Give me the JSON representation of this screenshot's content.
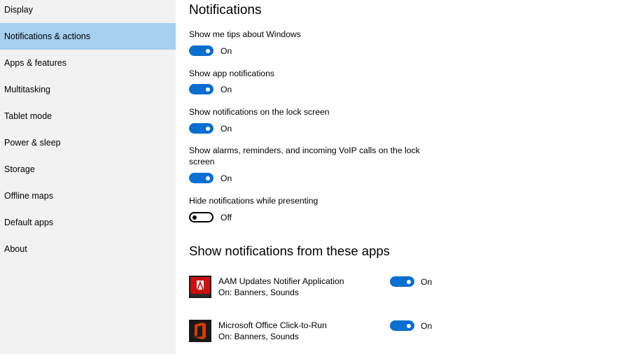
{
  "sidebar": {
    "items": [
      {
        "label": "Display"
      },
      {
        "label": "Notifications & actions"
      },
      {
        "label": "Apps & features"
      },
      {
        "label": "Multitasking"
      },
      {
        "label": "Tablet mode"
      },
      {
        "label": "Power & sleep"
      },
      {
        "label": "Storage"
      },
      {
        "label": "Offline maps"
      },
      {
        "label": "Default apps"
      },
      {
        "label": "About"
      }
    ],
    "selected": "Notifications & actions"
  },
  "main": {
    "title": "Notifications",
    "settings": [
      {
        "label": "Show me tips about Windows",
        "state": "On"
      },
      {
        "label": "Show app notifications",
        "state": "On"
      },
      {
        "label": "Show notifications on the lock screen",
        "state": "On"
      },
      {
        "label": "Show alarms, reminders, and incoming VoIP calls on the lock screen",
        "state": "On"
      },
      {
        "label": "Hide notifications while presenting",
        "state": "Off"
      }
    ],
    "apps_title": "Show notifications from these apps",
    "apps": [
      {
        "name": "AAM Updates Notifier Application",
        "detail": "On: Banners, Sounds",
        "state": "On",
        "icon": "adobe-icon"
      },
      {
        "name": "Microsoft Office Click-to-Run",
        "detail": "On: Banners, Sounds",
        "state": "On",
        "icon": "office-icon"
      }
    ]
  },
  "colors": {
    "accent": "#0a6fd0",
    "sidebar_bg": "#f2f2f2",
    "selected_bg": "#a6cff0",
    "adobe_red": "#cc0f0f",
    "office_orange": "#d83b01"
  }
}
